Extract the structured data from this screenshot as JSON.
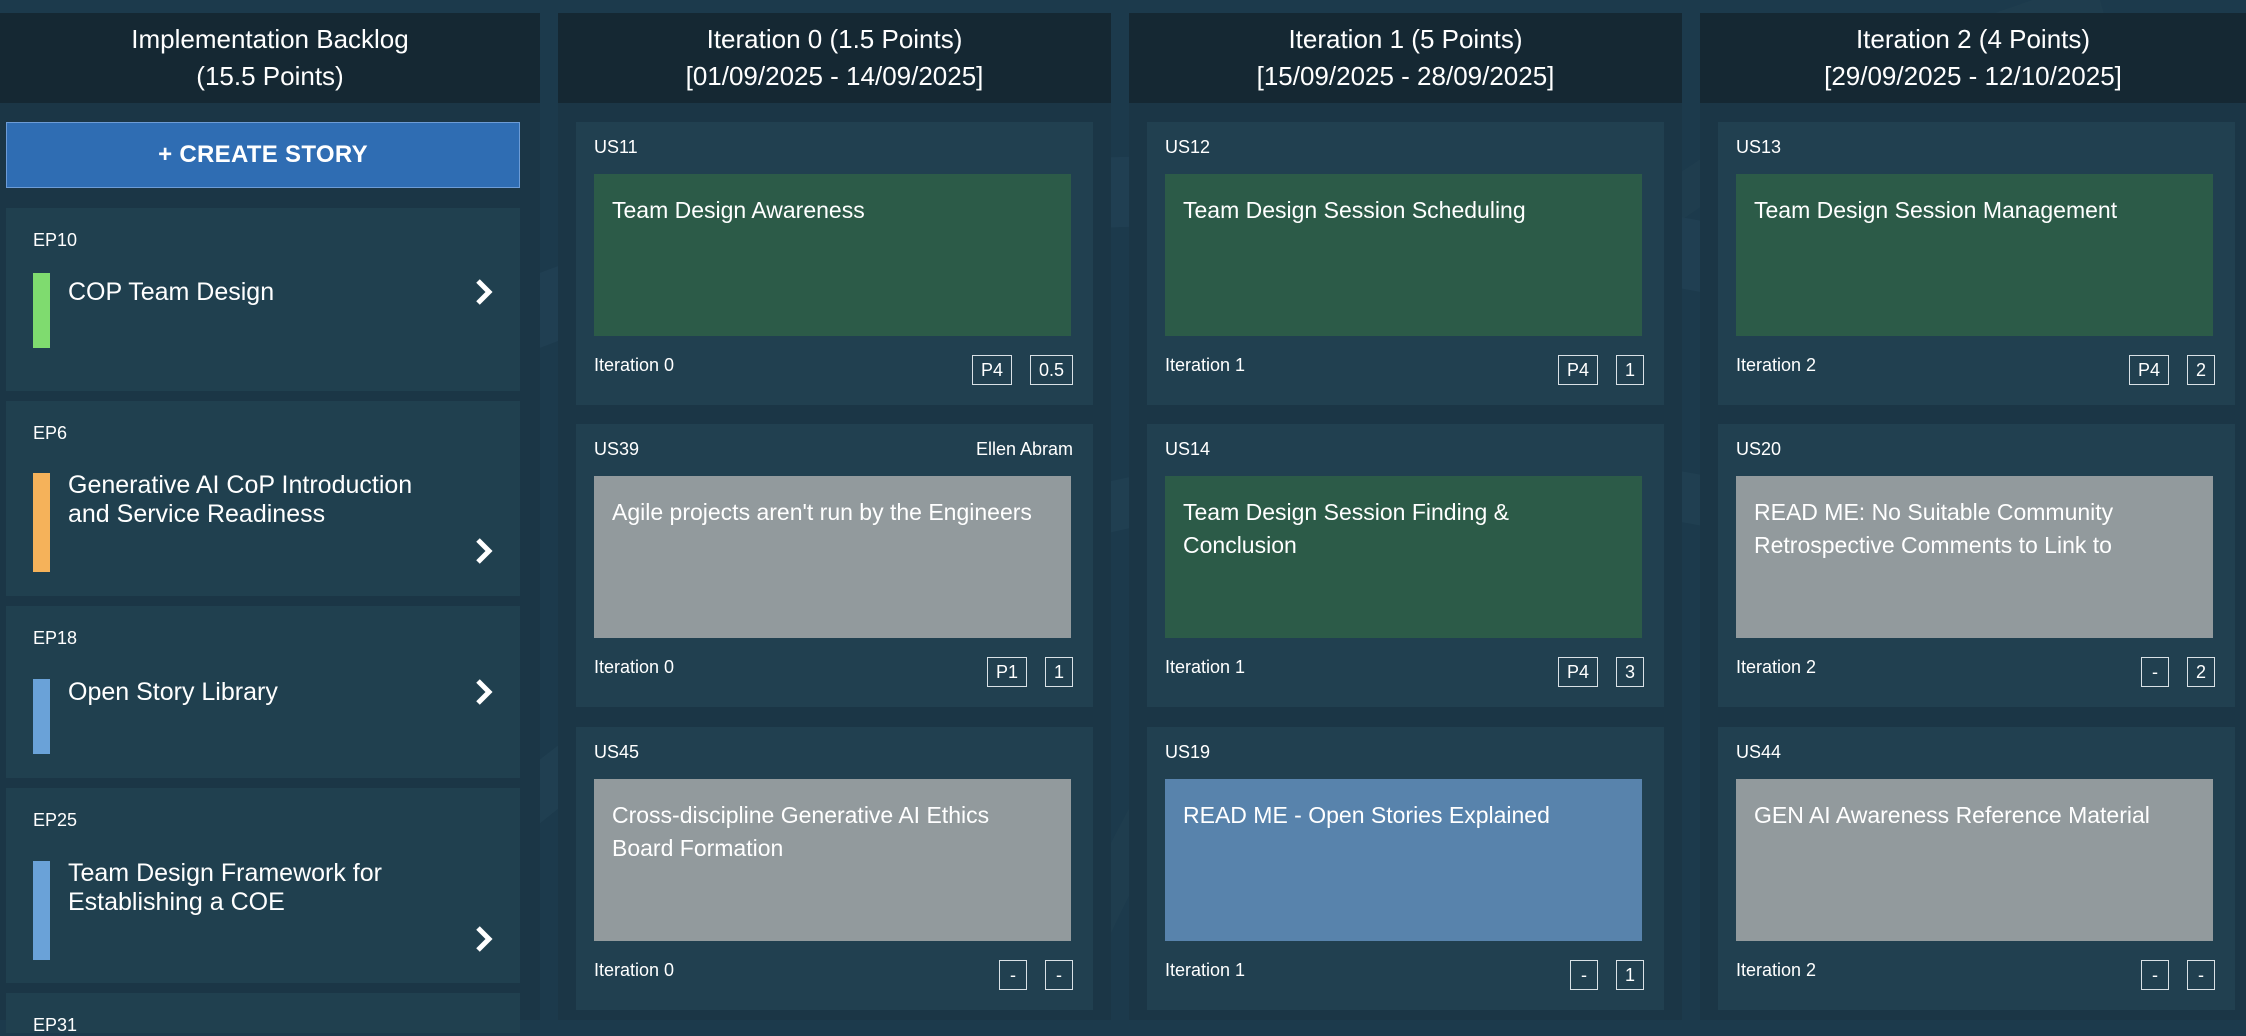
{
  "backlog": {
    "title": "Implementation Backlog",
    "points": "(15.5 Points)",
    "create_label": "+ CREATE STORY",
    "epics": [
      {
        "id": "EP10",
        "title": "COP Team Design",
        "color": "#7fdb6f"
      },
      {
        "id": "EP6",
        "title": "Generative AI CoP Introduction and Service Readiness",
        "color": "#f5b25a"
      },
      {
        "id": "EP18",
        "title": "Open Story Library",
        "color": "#6aa2d8"
      },
      {
        "id": "EP25",
        "title": "Team Design Framework for Establishing a COE",
        "color": "#6aa2d8"
      },
      {
        "id": "EP31"
      }
    ]
  },
  "iterations": [
    {
      "title": "Iteration 0 (1.5 Points)",
      "dates": "[01/09/2025 - 14/09/2025]",
      "cards": [
        {
          "id": "US11",
          "owner": "",
          "title": "Team Design Awareness",
          "color": "#2c5b48",
          "iteration": "Iteration 0",
          "priority": "P4",
          "points": "0.5"
        },
        {
          "id": "US39",
          "owner": "Ellen Abram",
          "title": "Agile projects aren't run by the Engineers",
          "color": "#929a9d",
          "iteration": "Iteration 0",
          "priority": "P1",
          "points": "1"
        },
        {
          "id": "US45",
          "owner": "",
          "title": "Cross-discipline Generative AI Ethics Board Formation",
          "color": "#929a9d",
          "iteration": "Iteration 0",
          "priority": "-",
          "points": "-"
        }
      ]
    },
    {
      "title": "Iteration 1 (5 Points)",
      "dates": "[15/09/2025 - 28/09/2025]",
      "cards": [
        {
          "id": "US12",
          "owner": "",
          "title": "Team Design Session Scheduling",
          "color": "#2c5b48",
          "iteration": "Iteration 1",
          "priority": "P4",
          "points": "1"
        },
        {
          "id": "US14",
          "owner": "",
          "title": "Team Design Session Finding & Conclusion",
          "color": "#2c5b48",
          "iteration": "Iteration 1",
          "priority": "P4",
          "points": "3"
        },
        {
          "id": "US19",
          "owner": "",
          "title": "READ ME - Open Stories Explained",
          "color": "#5883ac",
          "iteration": "Iteration 1",
          "priority": "-",
          "points": "1"
        }
      ]
    },
    {
      "title": "Iteration 2 (4 Points)",
      "dates": "[29/09/2025 - 12/10/2025]",
      "cards": [
        {
          "id": "US13",
          "owner": "",
          "title": "Team Design Session Management",
          "color": "#2c5b48",
          "iteration": "Iteration 2",
          "priority": "P4",
          "points": "2"
        },
        {
          "id": "US20",
          "owner": "",
          "title": "READ ME: No Suitable Community Retrospective Comments to Link to",
          "color": "#929a9d",
          "iteration": "Iteration 2",
          "priority": "-",
          "points": "2"
        },
        {
          "id": "US44",
          "owner": "",
          "title": "GEN AI Awareness Reference Material",
          "color": "#929a9d",
          "iteration": "Iteration 2",
          "priority": "-",
          "points": "-"
        }
      ]
    }
  ]
}
